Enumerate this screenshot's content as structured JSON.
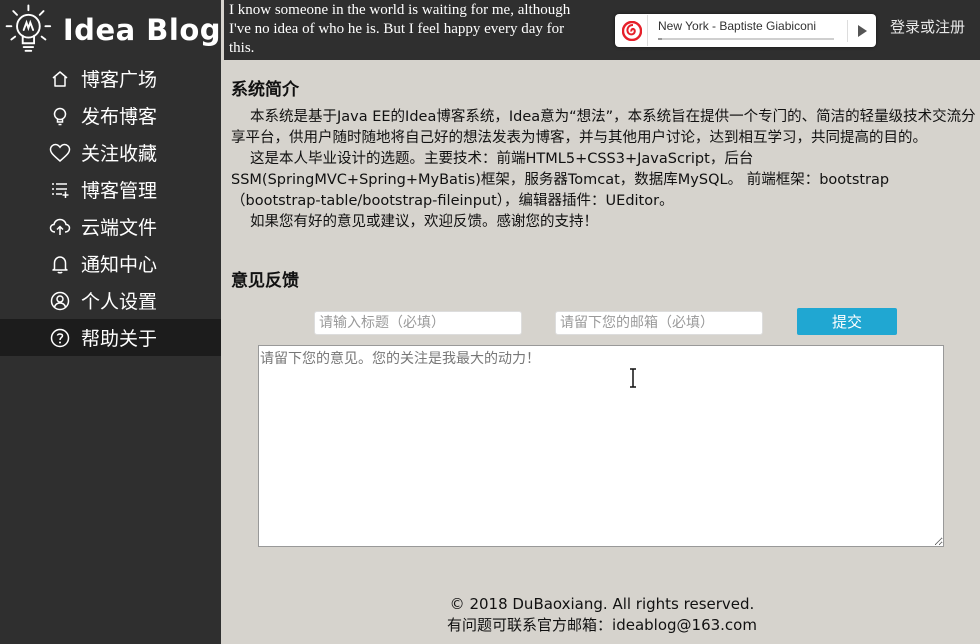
{
  "header": {
    "logo_text": "Idea Blog",
    "quote": "I know someone in the world is waiting for me, although I've no idea of who he is. But I feel happy every day for this.",
    "music": {
      "track": "New York - Baptiste Giabiconi",
      "progress_fraction": 0.02,
      "logo_icon": "netease-music-icon",
      "play_icon": "play-icon"
    },
    "login_label": "登录或注册"
  },
  "sidebar": {
    "items": [
      {
        "label": "博客广场",
        "icon": "home-icon"
      },
      {
        "label": "发布博客",
        "icon": "lightbulb-icon"
      },
      {
        "label": "关注收藏",
        "icon": "heart-icon"
      },
      {
        "label": "博客管理",
        "icon": "list-add-icon"
      },
      {
        "label": "云端文件",
        "icon": "cloud-upload-icon"
      },
      {
        "label": "通知中心",
        "icon": "bell-icon"
      },
      {
        "label": "个人设置",
        "icon": "user-icon"
      },
      {
        "label": "帮助关于",
        "icon": "help-icon"
      }
    ],
    "active_index": 7
  },
  "intro": {
    "title": "系统简介",
    "paragraphs": [
      "本系统是基于Java EE的Idea博客系统，Idea意为“想法”，本系统旨在提供一个专门的、简洁的轻量级技术交流分享平台，供用户随时随地将自己好的想法发表为博客，并与其他用户讨论，达到相互学习，共同提高的目的。",
      "这是本人毕业设计的选题。主要技术：前端HTML5+CSS3+JavaScript，后台SSM(SpringMVC+Spring+MyBatis)框架，服务器Tomcat，数据库MySQL。 前端框架：bootstrap（bootstrap-table/bootstrap-fileinput），编辑器插件：UEditor。",
      "如果您有好的意见或建议，欢迎反馈。感谢您的支持！"
    ]
  },
  "feedback": {
    "title": "意见反馈",
    "title_placeholder": "请输入标题（必填）",
    "email_placeholder": "请留下您的邮箱（必填）",
    "submit_label": "提交",
    "content_placeholder": "请留下您的意见。您的关注是我最大的动力！"
  },
  "footer": {
    "copyright": "© 2018 DuBaoxiang. All rights reserved.",
    "contact": "有问题可联系官方邮箱：ideablog@163.com"
  },
  "colors": {
    "dark": "#2f2f2f",
    "active": "#1c1c1c",
    "content_bg": "#d6d3cd",
    "accent": "#20a7d2",
    "music_red": "#e6202a"
  }
}
